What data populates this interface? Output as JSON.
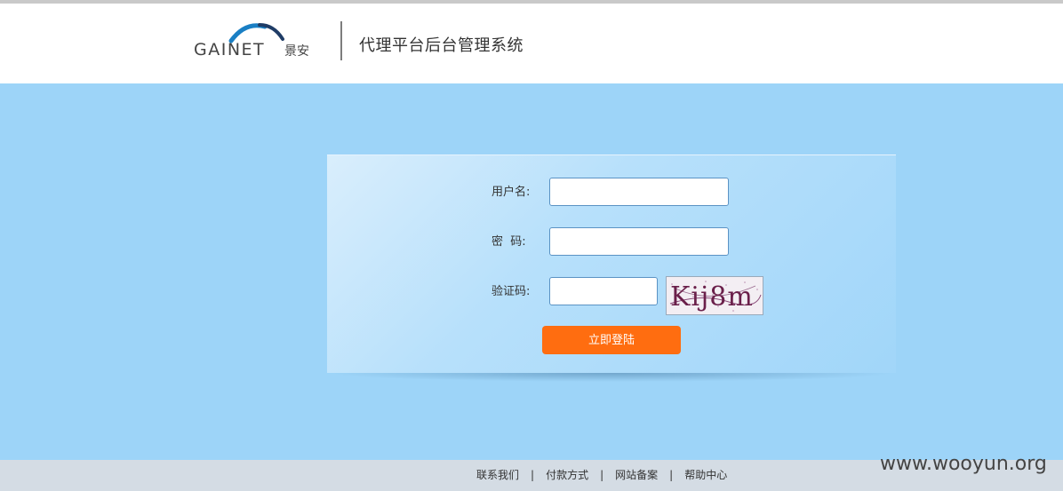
{
  "header": {
    "logo": {
      "wordmark": "GAINET",
      "chinese_mark": "景安",
      "colors": {
        "arc_blue": "#1a7fc4",
        "arc_dark": "#1f3c66",
        "text_grey": "#444444"
      }
    },
    "system_title": "代理平台后台管理系统"
  },
  "login_form": {
    "username_label": "用户名:",
    "username_value": "",
    "password_label": "密  码:",
    "password_value": "",
    "captcha_label": "验证码:",
    "captcha_value": "",
    "captcha_image_text": "Kij8m",
    "submit_label": "立即登陆"
  },
  "footer": {
    "links": [
      "联系我们",
      "付款方式",
      "网站备案",
      "帮助中心"
    ],
    "separator": "|"
  },
  "watermark": "www.wooyun.org",
  "colors": {
    "page_background": "#9dd4f8",
    "submit_button": "#ff6d10",
    "input_border": "#5b93c4",
    "footer_background": "#d4dce4"
  }
}
